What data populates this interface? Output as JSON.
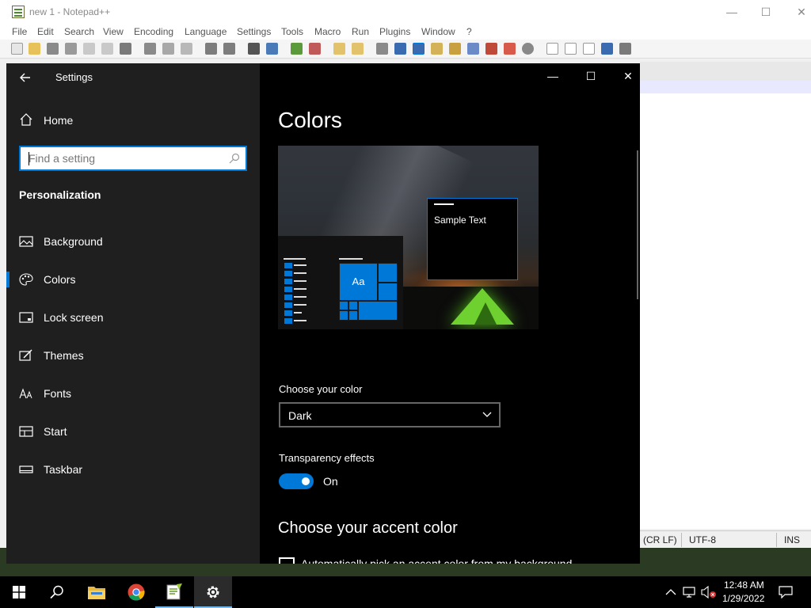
{
  "notepad": {
    "title": "new 1 - Notepad++",
    "window_controls": {
      "minimize": "—",
      "maximize": "☐",
      "close": "✕"
    },
    "menu": [
      "File",
      "Edit",
      "Search",
      "View",
      "Encoding",
      "Language",
      "Settings",
      "Tools",
      "Macro",
      "Run",
      "Plugins",
      "Window",
      "?"
    ],
    "status": {
      "eol": "(CR LF)",
      "encoding": "UTF-8",
      "mode": "INS"
    }
  },
  "settings": {
    "title": "Settings",
    "back_icon": "back-arrow-icon",
    "window_controls": {
      "minimize": "—",
      "maximize": "☐",
      "close": "✕"
    },
    "sidebar": {
      "home_label": "Home",
      "search_placeholder": "Find a setting",
      "section_heading": "Personalization",
      "items": [
        {
          "label": "Background",
          "icon": "picture-icon",
          "selected": false
        },
        {
          "label": "Colors",
          "icon": "palette-icon",
          "selected": true
        },
        {
          "label": "Lock screen",
          "icon": "lock-screen-icon",
          "selected": false
        },
        {
          "label": "Themes",
          "icon": "themes-icon",
          "selected": false
        },
        {
          "label": "Fonts",
          "icon": "fonts-icon",
          "selected": false
        },
        {
          "label": "Start",
          "icon": "start-icon",
          "selected": false
        },
        {
          "label": "Taskbar",
          "icon": "taskbar-icon",
          "selected": false
        }
      ]
    },
    "content": {
      "title": "Colors",
      "preview": {
        "tile_text": "Aa",
        "sample_text": "Sample Text"
      },
      "choose_color": {
        "label": "Choose your color",
        "value": "Dark"
      },
      "transparency": {
        "label": "Transparency effects",
        "state": "On",
        "on": true
      },
      "accent_heading": "Choose your accent color",
      "auto_accent_label": "Automatically pick an accent color from my background"
    },
    "accent_color": "#0078d7"
  },
  "taskbar": {
    "apps": [
      "start-icon",
      "search-icon",
      "file-explorer-icon",
      "chrome-icon",
      "notepad-plus-plus-icon",
      "settings-gear-icon"
    ],
    "clock_time": "12:48 AM",
    "clock_date": "1/29/2022"
  }
}
